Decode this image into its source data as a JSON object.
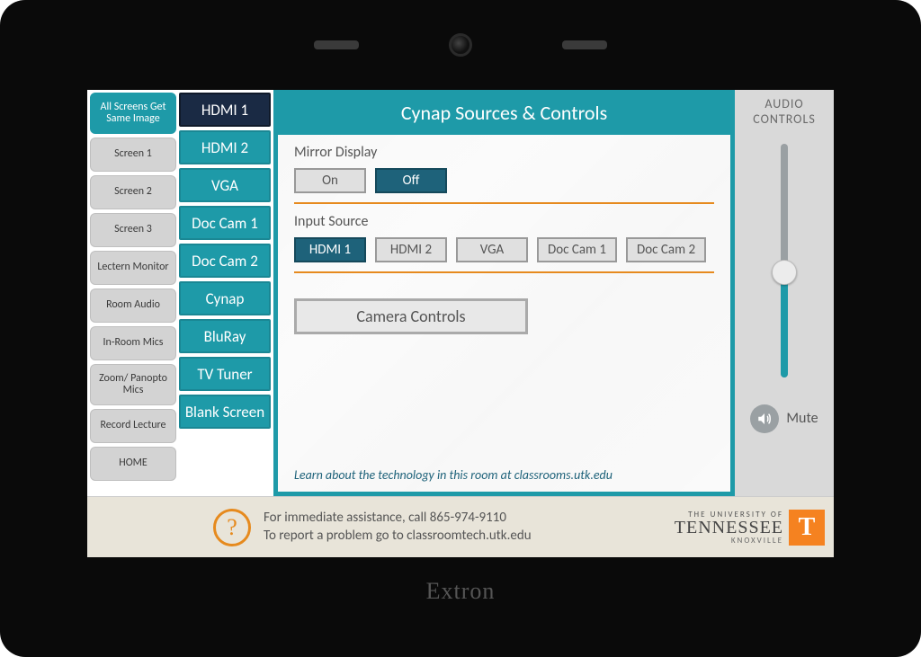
{
  "device": {
    "brand": "Extron"
  },
  "nav": {
    "items": [
      {
        "label": "All Screens Get Same Image",
        "active": true
      },
      {
        "label": "Screen 1"
      },
      {
        "label": "Screen 2"
      },
      {
        "label": "Screen 3"
      },
      {
        "label": "Lectern Monitor"
      },
      {
        "label": "Room Audio"
      },
      {
        "label": "In-Room Mics"
      },
      {
        "label": "Zoom/ Panopto Mics"
      },
      {
        "label": "Record Lecture"
      },
      {
        "label": "HOME"
      }
    ]
  },
  "sources": {
    "items": [
      {
        "label": "HDMI 1",
        "selected": true
      },
      {
        "label": "HDMI 2"
      },
      {
        "label": "VGA"
      },
      {
        "label": "Doc Cam 1"
      },
      {
        "label": "Doc Cam 2"
      },
      {
        "label": "Cynap"
      },
      {
        "label": "BluRay"
      },
      {
        "label": "TV Tuner"
      },
      {
        "label": "Blank Screen"
      }
    ]
  },
  "header": {
    "title": "Cynap Sources & Controls"
  },
  "mirror": {
    "label": "Mirror Display",
    "on": "On",
    "off": "Off",
    "state": "off"
  },
  "input": {
    "label": "Input Source",
    "options": [
      {
        "label": "HDMI 1",
        "selected": true
      },
      {
        "label": "HDMI 2"
      },
      {
        "label": "VGA"
      },
      {
        "label": "Doc Cam 1"
      },
      {
        "label": "Doc Cam 2"
      }
    ]
  },
  "camera": {
    "button": "Camera Controls"
  },
  "info": {
    "learn": "Learn about the technology in this room at classrooms.utk.edu"
  },
  "audio": {
    "title_line1": "AUDIO",
    "title_line2": "CONTROLS",
    "level_pct": 45,
    "mute_label": "Mute"
  },
  "footer": {
    "line1": "For immediate assistance, call 865-974-9110",
    "line2": "To report a problem go to classroomtech.utk.edu"
  },
  "university": {
    "top": "THE UNIVERSITY OF",
    "main": "TENNESSEE",
    "sub": "KNOXVILLE",
    "t": "T"
  }
}
